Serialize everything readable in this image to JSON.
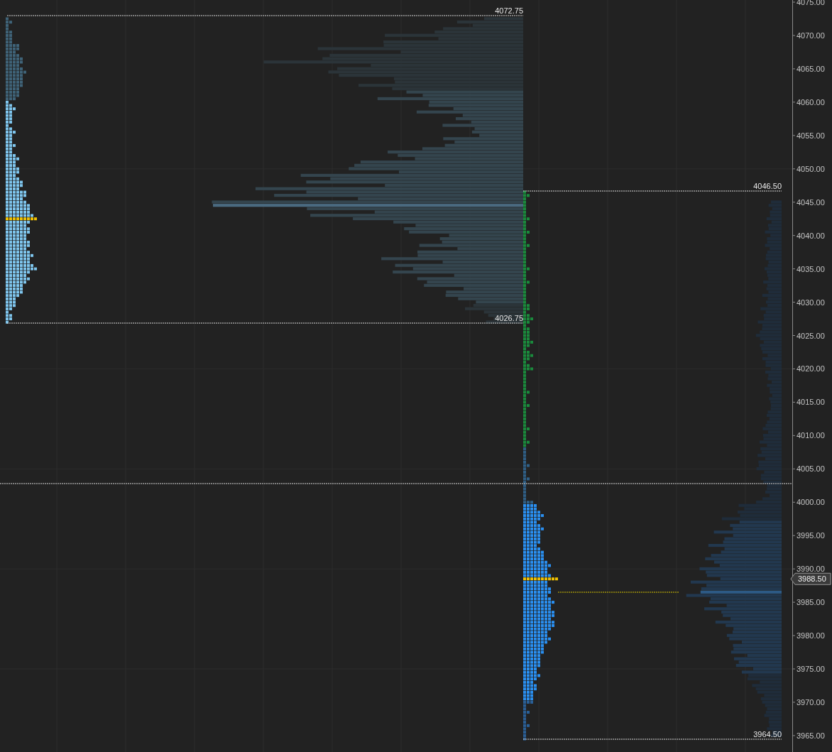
{
  "levels": [
    {
      "label": "4072.75"
    },
    {
      "label": "4026.75"
    },
    {
      "label": "4046.50"
    },
    {
      "label": "3964.50"
    }
  ],
  "price_axis": {
    "labels": [
      "4075.00",
      "4070.00",
      "4065.00",
      "4060.00",
      "4055.00",
      "4050.00",
      "4045.00",
      "4040.00",
      "4035.00",
      "4030.00",
      "4025.00",
      "4020.00",
      "4015.00",
      "4010.00",
      "4005.00",
      "4000.00",
      "3995.00",
      "3990.00",
      "3985.00",
      "3980.00",
      "3975.00",
      "3970.00",
      "3965.00"
    ],
    "current_price": "3988.50"
  }
}
